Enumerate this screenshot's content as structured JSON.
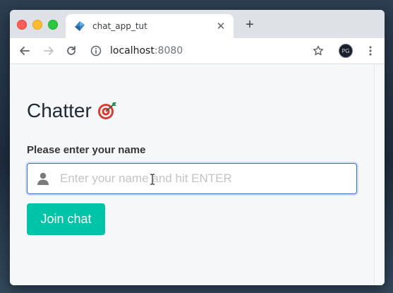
{
  "browser": {
    "tab_title": "chat_app_tut",
    "url_host": "localhost",
    "url_port": ":8080",
    "profile_initials": "PG"
  },
  "page": {
    "heading": "Chatter",
    "heading_emoji": "target-dart-icon",
    "name_label": "Please enter your name",
    "name_input": {
      "value": "",
      "placeholder": "Enter your name and hit ENTER"
    },
    "join_button_label": "Join chat"
  },
  "colors": {
    "accent_primary": "#00c4a7",
    "focus_border": "#3273dc"
  }
}
